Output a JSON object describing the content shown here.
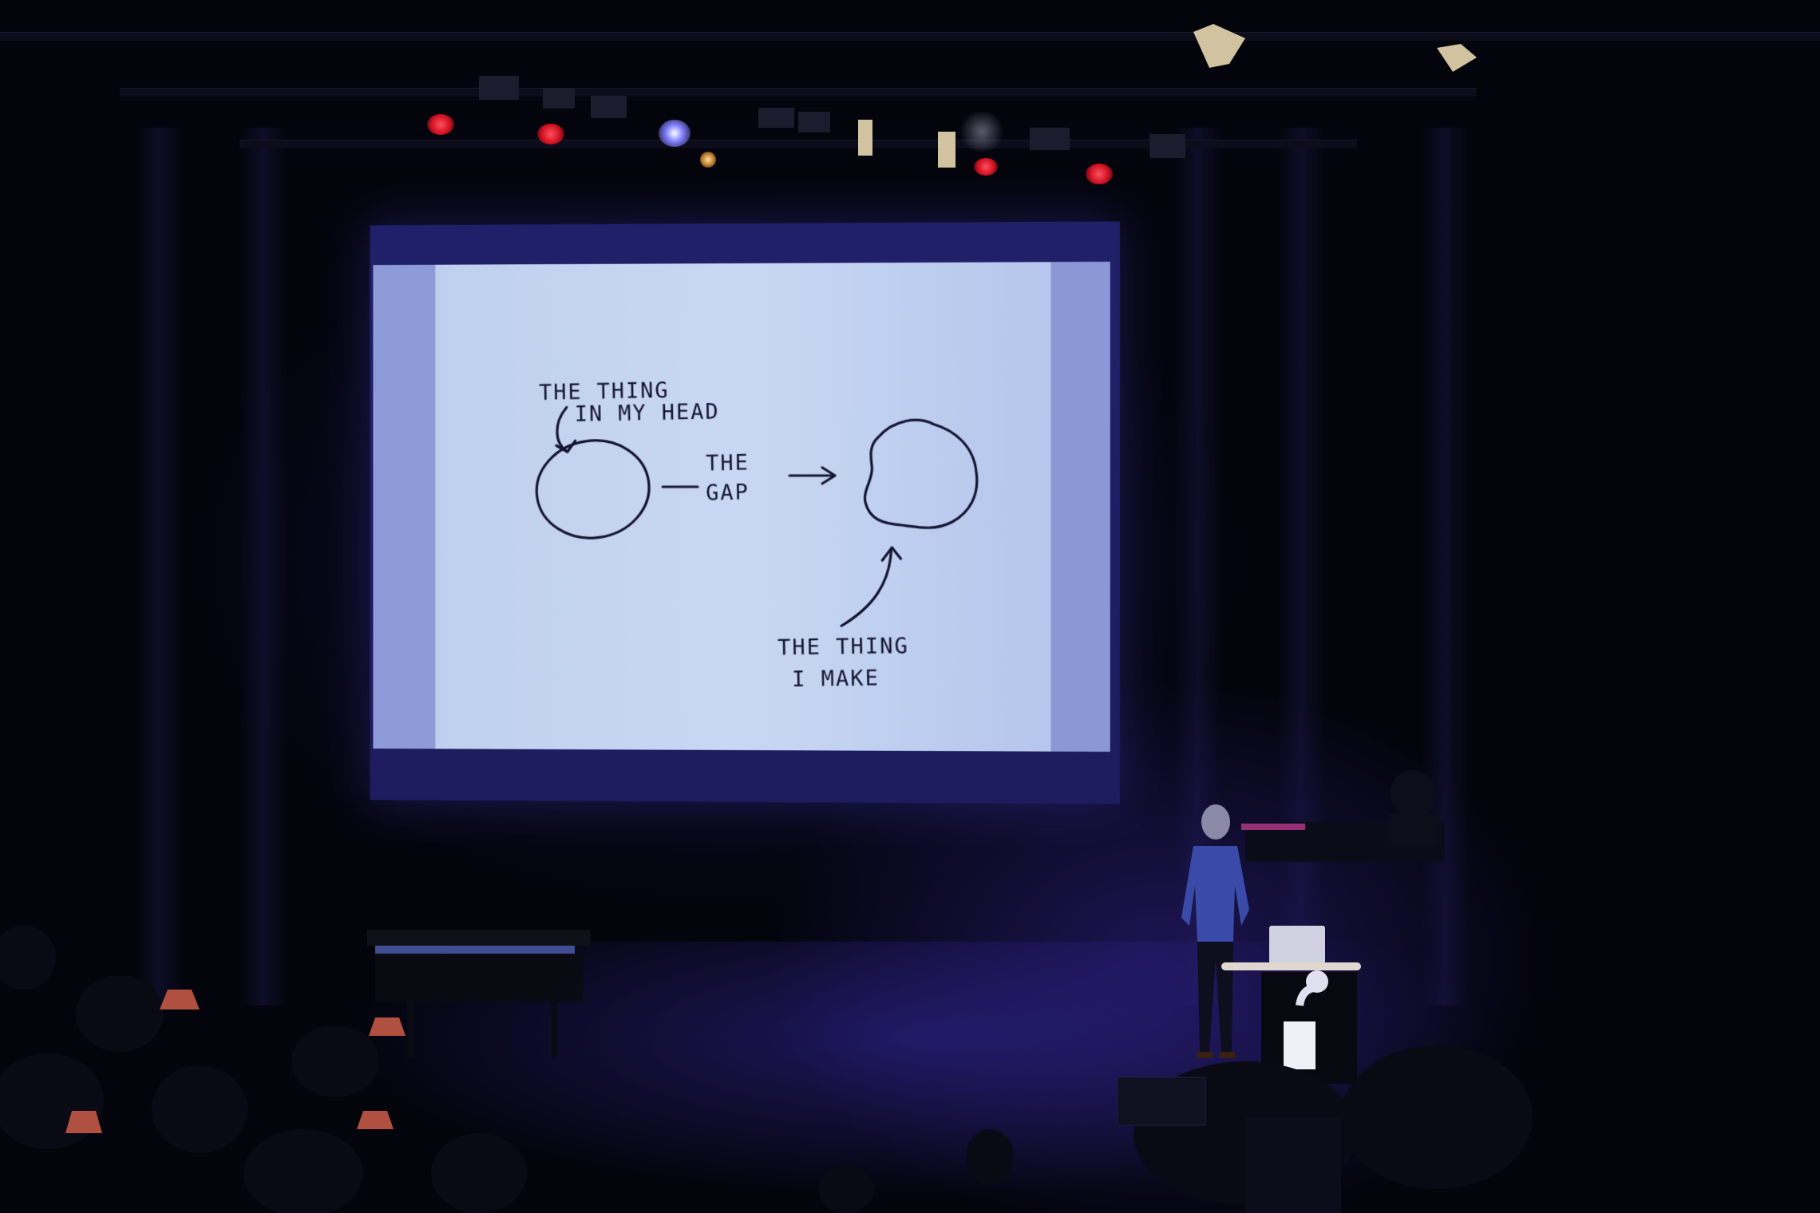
{
  "slide": {
    "label_head_line1": "THE THING",
    "label_head_line2": "IN MY HEAD",
    "label_gap_line1": "THE",
    "label_gap_line2": "GAP",
    "label_make_line1": "THE THING",
    "label_make_line2": "I MAKE"
  },
  "colors": {
    "slide_ink": "#141432",
    "slide_paper": "#c8d8f3",
    "stage_light": "#3a2bd0",
    "spot_red": "#ff2030"
  }
}
